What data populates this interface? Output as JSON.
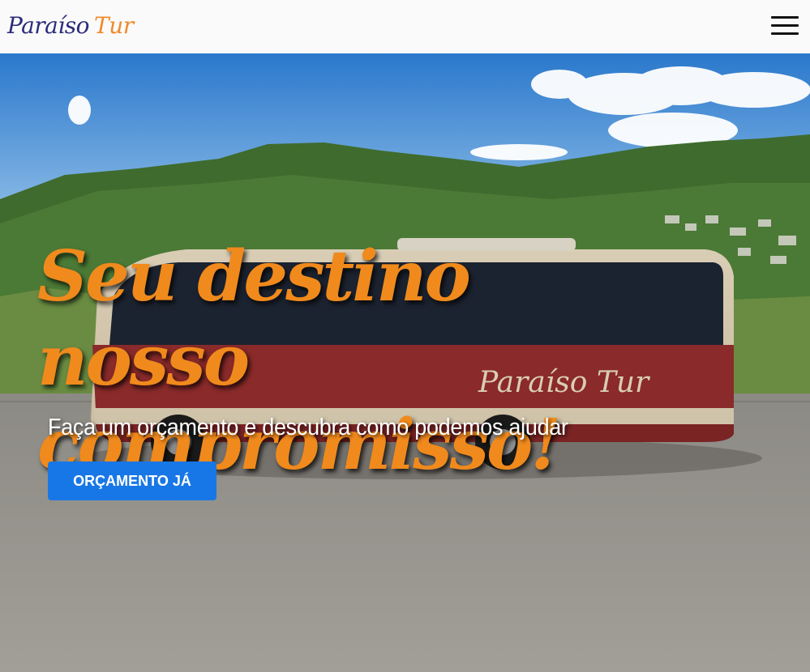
{
  "header": {
    "logo": {
      "part1": "Paraíso",
      "part2": "Tur"
    },
    "menu_icon": "hamburger-menu-icon"
  },
  "hero": {
    "headline": "Seu destino nosso compromisso!",
    "subtitle": "Faça um orçamento e descubra como podemos ajudar",
    "cta_label": "ORÇAMENTO JÁ",
    "bus_logo_text": "Paraíso Tur"
  },
  "colors": {
    "brand_navy": "#2b2c7a",
    "brand_orange": "#f08a2a",
    "headline_orange": "#f08a1c",
    "cta_blue": "#1877e6",
    "bus_red": "#8a2a2a"
  }
}
